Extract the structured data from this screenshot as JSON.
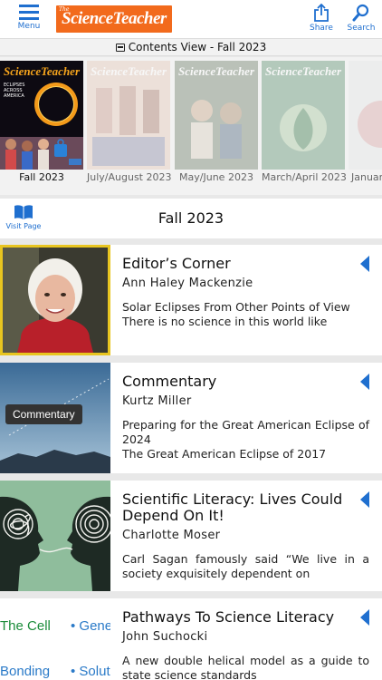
{
  "topbar": {
    "menu_label": "Menu",
    "logo_small": "The",
    "logo_text": "ScienceTeacher",
    "share_label": "Share",
    "search_label": "Search"
  },
  "contents_view": {
    "label": "Contents View - Fall 2023"
  },
  "covers": [
    {
      "label": "Fall 2023",
      "selected": true,
      "mast": "ScienceTeacher",
      "headline": "ECLIPSES ACROSS AMERICA"
    },
    {
      "label": "July/August 2023",
      "mast": "ScienceTeacher"
    },
    {
      "label": "May/June 2023",
      "mast": "ScienceTeacher"
    },
    {
      "label": "March/April 2023",
      "mast": "ScienceTeacher"
    },
    {
      "label": "January/"
    }
  ],
  "issue": {
    "title": "Fall 2023",
    "visit_label": "Visit Page"
  },
  "articles": [
    {
      "title": "Editor’s Corner",
      "author": "Ann Haley Mackenzie",
      "desc1": "Solar Eclipses From Other Points of View",
      "desc2": "There is no science in this world like"
    },
    {
      "title": "Commentary",
      "author": "Kurtz Miller",
      "badge": "Commentary",
      "desc1": "Preparing for the Great American Eclipse of 2024",
      "desc2": "The Great American Eclipse of 2017"
    },
    {
      "title": "Scientific Literacy: Lives Could Depend On It!",
      "author": "Charlotte Moser",
      "desc1": "Carl Sagan famously said “We live in a society exquisitely dependent on",
      "desc2": ""
    },
    {
      "title": "Pathways To Science Literacy",
      "author": "John Suchocki",
      "desc1": "A new double helical model as a guide to state science standards",
      "desc2": "",
      "img_words": [
        "The Cell",
        "• Geneti",
        "Bonding",
        "• Solut"
      ]
    }
  ],
  "colors": {
    "accent": "#1f6fcf",
    "logo": "#f26a1c",
    "selected_border": "#e8c520"
  }
}
